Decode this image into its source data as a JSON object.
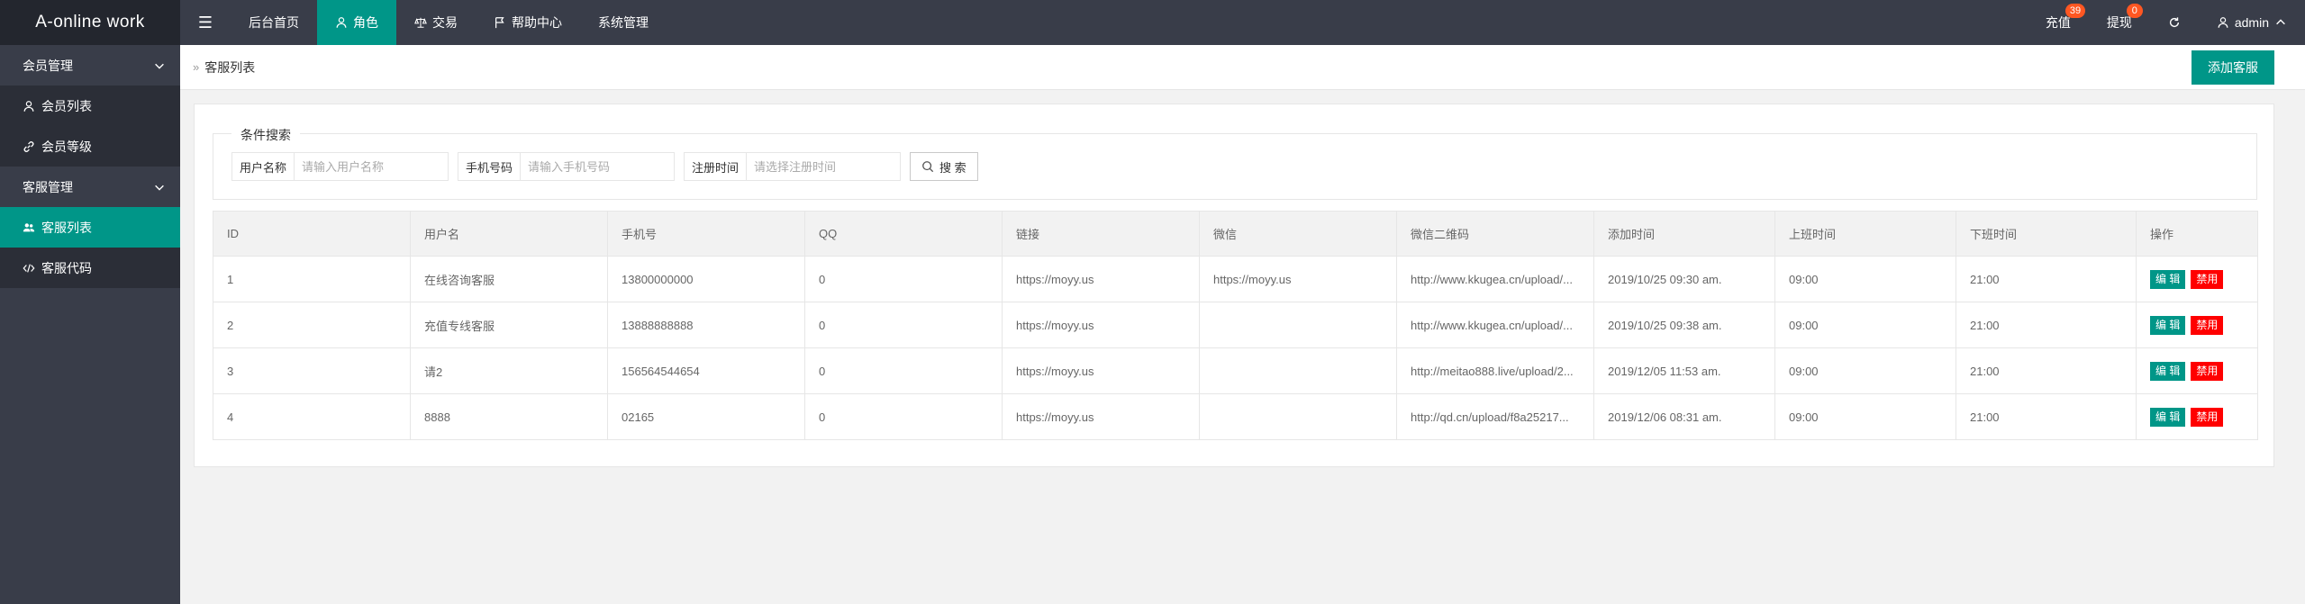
{
  "header": {
    "logo": "A-online work",
    "nav": [
      {
        "label": "后台首页",
        "active": false
      },
      {
        "label": "角色",
        "active": true
      },
      {
        "label": "交易",
        "active": false
      },
      {
        "label": "帮助中心",
        "active": false
      },
      {
        "label": "系统管理",
        "active": false
      }
    ],
    "recharge": {
      "label": "充值",
      "count": "39"
    },
    "withdraw": {
      "label": "提现",
      "count": "0"
    },
    "user": "admin"
  },
  "sidebar": {
    "groups": [
      {
        "label": "会员管理",
        "items": [
          {
            "label": "会员列表",
            "icon": "user-icon"
          },
          {
            "label": "会员等级",
            "icon": "link-icon"
          }
        ]
      },
      {
        "label": "客服管理",
        "items": [
          {
            "label": "客服列表",
            "icon": "users-icon",
            "active": true
          },
          {
            "label": "客服代码",
            "icon": "code-icon"
          }
        ]
      }
    ]
  },
  "breadcrumb": "客服列表",
  "add_button": "添加客服",
  "search": {
    "legend": "条件搜索",
    "username": {
      "label": "用户名称",
      "placeholder": "请输入用户名称"
    },
    "phone": {
      "label": "手机号码",
      "placeholder": "请输入手机号码"
    },
    "regtime": {
      "label": "注册时间",
      "placeholder": "请选择注册时间"
    },
    "button": "搜 索"
  },
  "table": {
    "columns": [
      "ID",
      "用户名",
      "手机号",
      "QQ",
      "链接",
      "微信",
      "微信二维码",
      "添加时间",
      "上班时间",
      "下班时间",
      "操作"
    ],
    "rows": [
      [
        "1",
        "在线咨询客服",
        "13800000000",
        "0",
        "https://moyy.us",
        "https://moyy.us",
        "http://www.kkugea.cn/upload/...",
        "2019/10/25 09:30 am.",
        "09:00",
        "21:00"
      ],
      [
        "2",
        "充值专线客服",
        "13888888888",
        "0",
        "https://moyy.us",
        "",
        "http://www.kkugea.cn/upload/...",
        "2019/10/25 09:38 am.",
        "09:00",
        "21:00"
      ],
      [
        "3",
        "请2",
        "156564544654",
        "0",
        "https://moyy.us",
        "",
        "http://meitao888.live/upload/2...",
        "2019/12/05 11:53 am.",
        "09:00",
        "21:00"
      ],
      [
        "4",
        "8888",
        "02165",
        "0",
        "https://moyy.us",
        "",
        "http://qd.cn/upload/f8a25217...",
        "2019/12/06 08:31 am.",
        "09:00",
        "21:00"
      ]
    ],
    "edit_label": "编 辑",
    "disable_label": "禁用"
  },
  "colors": {
    "accent": "#009688",
    "danger": "#ff0000",
    "badge": "#ff5722",
    "header": "#393d49"
  }
}
